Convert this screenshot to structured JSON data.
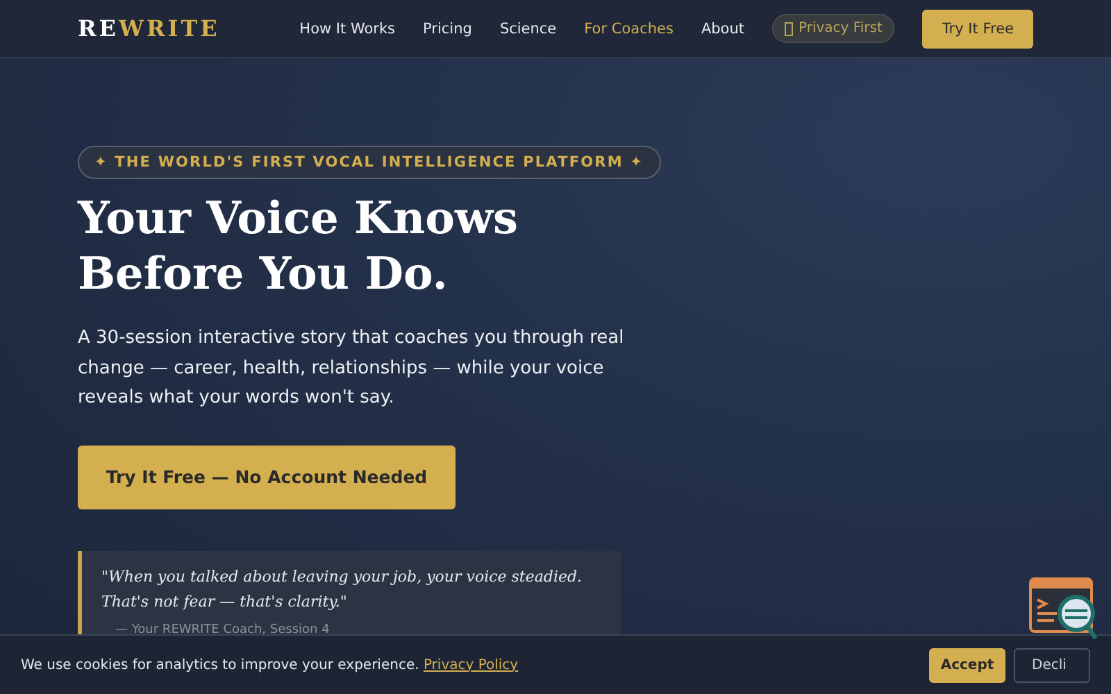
{
  "brand": {
    "part_1": "RE",
    "part_2": "WRITE"
  },
  "nav": [
    {
      "label": "How It Works",
      "selected": false
    },
    {
      "label": "Pricing",
      "selected": false
    },
    {
      "label": "Science",
      "selected": false
    },
    {
      "label": "For Coaches",
      "selected": true
    },
    {
      "label": "About",
      "selected": false
    }
  ],
  "privacy_badge": "Privacy First",
  "nav_cta": "Try It Free",
  "hero": {
    "eyebrow": "✦ THE WORLD'S FIRST VOCAL INTELLIGENCE PLATFORM ✦",
    "title_lines": [
      "Your Voice Knows",
      "Before You Do."
    ],
    "lead": "A 30-session interactive story that coaches you through real change — career, health, relationships — while your voice reveals what your words won't say.",
    "cta": "Try It Free — No Account Needed",
    "quote": "\"When you talked about leaving your job, your voice steadied. That's not fear — that's clarity.\"",
    "attribution": "— Your REWRITE Coach, Session 4"
  },
  "cookie_bar": {
    "text": "We use cookies for analytics to improve your experience.",
    "link": "Privacy Policy",
    "accept": "Accept",
    "decline": "Decli"
  }
}
